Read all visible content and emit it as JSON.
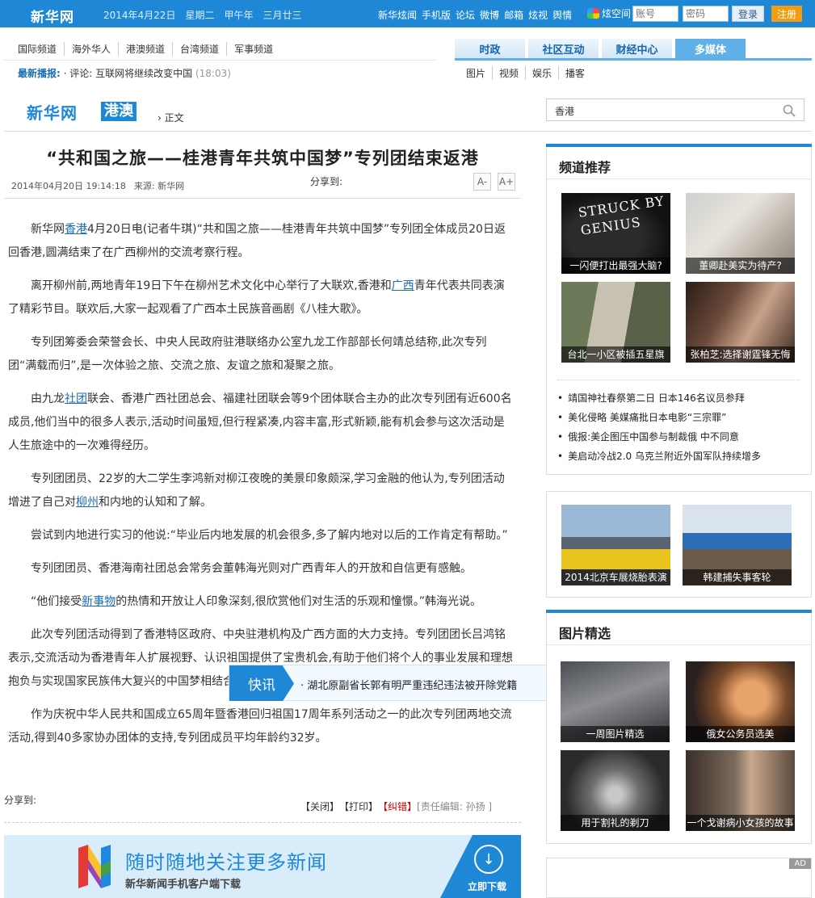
{
  "top": {
    "logo": "新华网",
    "date": "2014年4月22日",
    "weekday": "星期二",
    "lunar_year": "甲午年",
    "lunar_day": "三月廿三",
    "links": [
      "新华炫闻",
      "手机版",
      "论坛",
      "微博",
      "邮箱",
      "炫视",
      "舆情"
    ],
    "xuan_label": "炫空间",
    "account_placeholder": "账号",
    "password_placeholder": "密码",
    "login": "登录",
    "register": "注册"
  },
  "channels": [
    "国际频道",
    "海外华人",
    "港澳频道",
    "台湾频道",
    "军事频道"
  ],
  "broadcast": {
    "label": "最新播报:",
    "text": "· 评论: 互联网将继续改变中国",
    "time": "(18:03)"
  },
  "tabs": [
    "时政",
    "社区互动",
    "财经中心",
    "多媒体"
  ],
  "subtabs": [
    "图片",
    "视频",
    "娱乐",
    "播客"
  ],
  "brand": {
    "name": "新华网",
    "channel": "港澳",
    "crumb": "正文"
  },
  "search": {
    "value": "香港"
  },
  "article": {
    "title": "“共和国之旅——桂港青年共筑中国梦”专列团结束返港",
    "date": "2014年04月20日 19:14:18",
    "source_label": "来源:",
    "source": "新华网",
    "share_label": "分享到:",
    "font_smaller": "A-",
    "font_bigger": "A+",
    "paragraphs": [
      {
        "a": "新华网",
        "link": "香港",
        "b": "4月20日电(记者牛琪)“共和国之旅——桂港青年共筑中国梦”专列团全体成员20日返回香港,圆满结束了在广西柳州的交流考察行程。"
      },
      {
        "a": "离开柳州前,两地青年19日下午在柳州艺术文化中心举行了大联欢,香港和",
        "link": "广西",
        "b": "青年代表共同表演了精彩节目。联欢后,大家一起观看了广西本土民族音画剧《八桂大歌》。"
      },
      {
        "a": "专列团筹委会荣誉会长、中央人民政府驻港联络办公室九龙工作部部长何靖总结称,此次专列团“满载而归”,是一次体验之旅、交流之旅、友谊之旅和凝聚之旅。",
        "link": "",
        "b": ""
      },
      {
        "a": "由九龙",
        "link": "社团",
        "b": "联会、香港广西社团总会、福建社团联会等9个团体联合主办的此次专列团有近600名成员,他们当中的很多人表示,活动时间虽短,但行程紧凑,内容丰富,形式新颖,能有机会参与这次活动是人生旅途中的一次难得经历。"
      },
      {
        "a": "专列团团员、22岁的大二学生李鸿新对柳江夜晚的美景印象颇深,学习金融的他认为,专列团活动增进了自己对",
        "link": "柳州",
        "b": "和内地的认知和了解。"
      },
      {
        "a": "尝试到内地进行实习的他说:“毕业后内地发展的机会很多,多了解内地对以后的工作肯定有帮助。”",
        "link": "",
        "b": ""
      },
      {
        "a": "专列团团员、香港海南社团总会常务会董韩海光则对广西青年人的开放和自信更有感触。",
        "link": "",
        "b": ""
      },
      {
        "a": "“他们接受",
        "link": "新事物",
        "b": "的热情和开放让人印象深刻,很欣赏他们对生活的乐观和憧憬。”韩海光说。"
      },
      {
        "a": "此次专列团活动得到了香港特区政府、中央驻港机构及广西方面的大力支持。专列团团长吕鸿铭表示,交流活动为香港青年人扩展视野、认识祖国提供了宝贵机会,有助于他们将个人的事业发展和理想抱负与实现国家民族伟大复兴的中国梦相结合,提供了一个很好的平台。",
        "link": "",
        "b": ""
      },
      {
        "a": "作为庆祝中华人民共和国成立65周年暨香港回归祖国17周年系列活动之一的此次专列团两地交流活动,得到40多家协办团体的支持,专列团成员平均年龄约32岁。",
        "link": "",
        "b": ""
      }
    ],
    "share_bottom": "分享到:",
    "close": "【关闭】",
    "print": "【打印】",
    "correct": "【纠错】",
    "editor": "[责任编辑: 孙扬 ]"
  },
  "banner": {
    "line1": "随时随地关注更多新闻",
    "line2": "新华新闻手机客户端下载",
    "download": "立即下载",
    "colors": [
      "#e53935",
      "#fbc02d",
      "#43a047",
      "#1e88e5",
      "#8e24aa"
    ]
  },
  "flash": {
    "tag": "快讯",
    "text": "· 湖北原副省长郭有明严重违纪违法被开除党籍",
    "close": "×"
  },
  "sidebar": {
    "recommend_title": "频道推荐",
    "thumbs": [
      {
        "cap": "一闪便打出最强大脑?",
        "art": "STRUCK BY GENIUS"
      },
      {
        "cap": "董卿赴美实为待产?"
      },
      {
        "cap": "台北一小区被插五星旗"
      },
      {
        "cap": "张柏芝:选择谢霆锋无悔"
      }
    ],
    "list": [
      "靖国神社春祭第二日 日本146名议员参拜",
      "美化侵略 美媒痛批日本电影“三宗罪”",
      "俄报:美企图压中国参与制裁俄 中不同意",
      "美启动冷战2.0 乌克兰附近外国军队持续增多"
    ],
    "mid_thumbs": [
      {
        "cap": "2014北京车展烧胎表演"
      },
      {
        "cap": "韩建捕失事客轮"
      }
    ],
    "photos_title": "图片精选",
    "photos": [
      {
        "cap": "一周图片精选"
      },
      {
        "cap": "俄女公务员选美"
      },
      {
        "cap": "用于割礼的剃刀"
      },
      {
        "cap": "一个戈谢病小女孩的故事"
      }
    ],
    "ad": "AD"
  }
}
